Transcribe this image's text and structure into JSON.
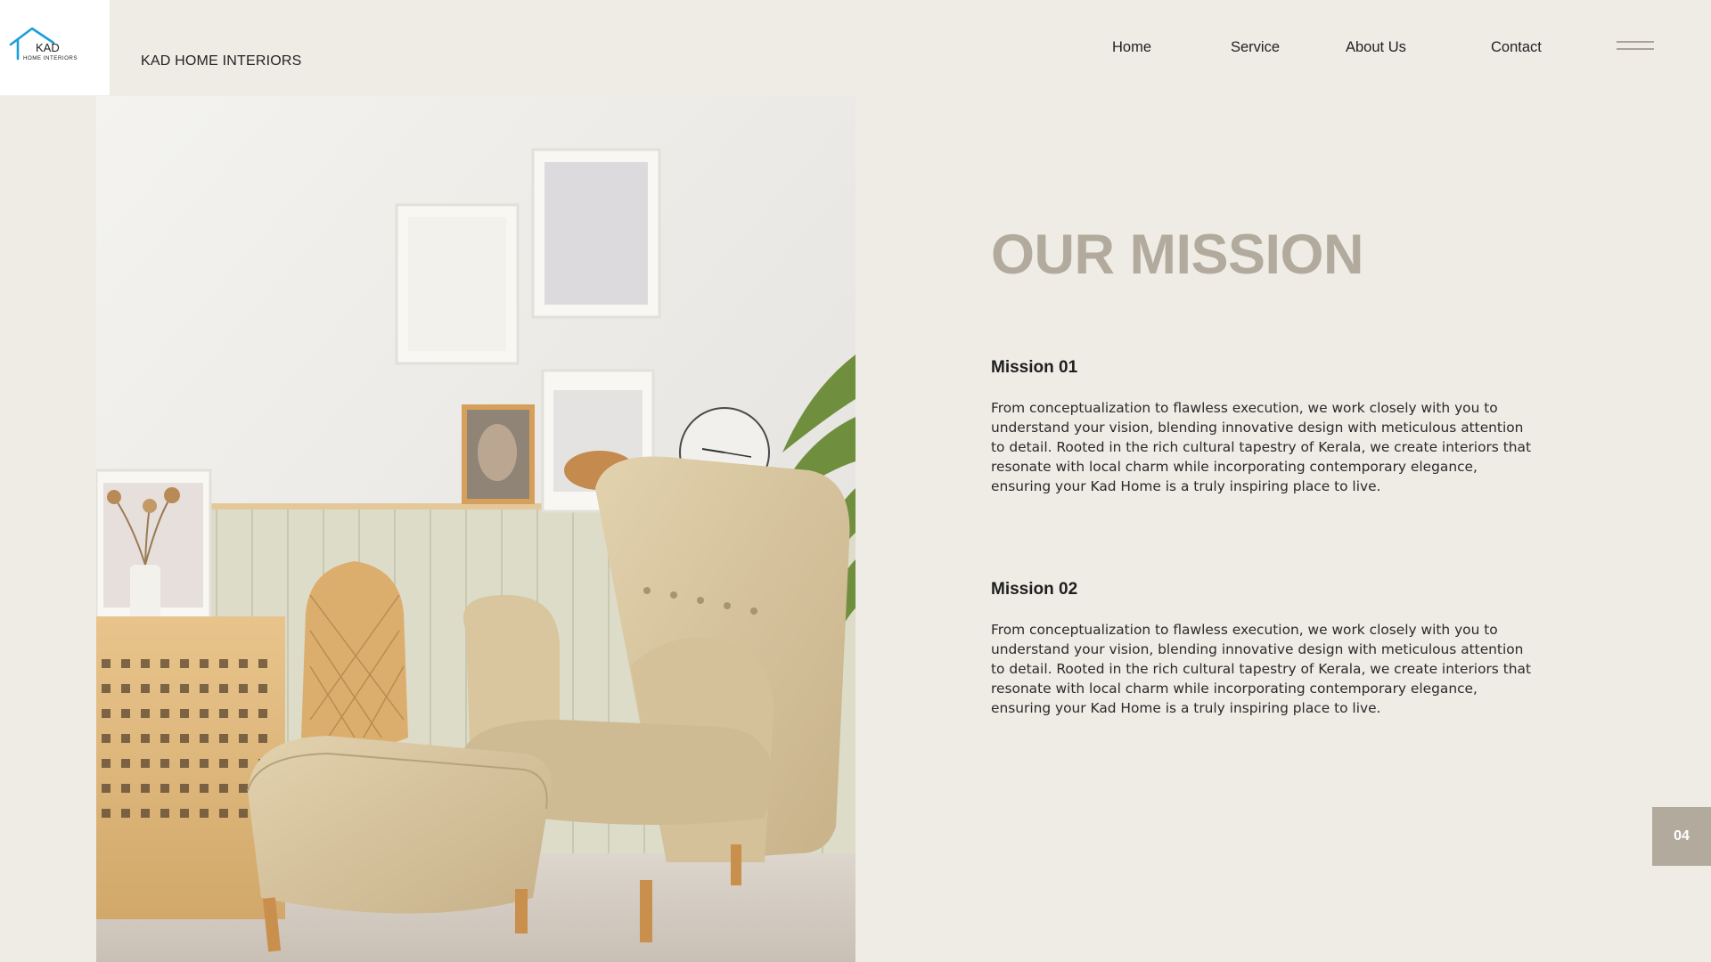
{
  "header": {
    "logo": {
      "icon": "house-roof-logo",
      "word_main": "KAD",
      "word_sub": "HOME INTERIORS",
      "accent_color": "#1a9fd9"
    },
    "brand_name": "KAD HOME INTERIORS",
    "nav": {
      "home": "Home",
      "service": "Service",
      "about": "About Us",
      "contact": "Contact"
    },
    "menu_icon": "hamburger-menu-icon"
  },
  "hero_image": {
    "subject": "living-room-armchair-photo"
  },
  "mission": {
    "title": "OUR MISSION",
    "title_color": "#b2aa9d",
    "items": [
      {
        "heading": "Mission 01",
        "body": "From conceptualization to flawless execution, we work closely with you to understand your vision, blending innovative design with meticulous attention to detail. Rooted in the rich cultural tapestry of Kerala, we create interiors that resonate with local charm while incorporating contemporary elegance, ensuring your Kad Home is a truly inspiring place to live."
      },
      {
        "heading": "Mission 02",
        "body": "From conceptualization to flawless execution, we work closely with you to understand your vision, blending innovative design with meticulous attention to detail. Rooted in the rich cultural tapestry of Kerala, we create interiors that resonate with local charm while incorporating contemporary elegance, ensuring your Kad Home is a truly inspiring place to live."
      }
    ]
  },
  "page_number": "04",
  "colors": {
    "background": "#efece6",
    "accent_beige": "#b2aa9d",
    "text_dark": "#222222"
  }
}
